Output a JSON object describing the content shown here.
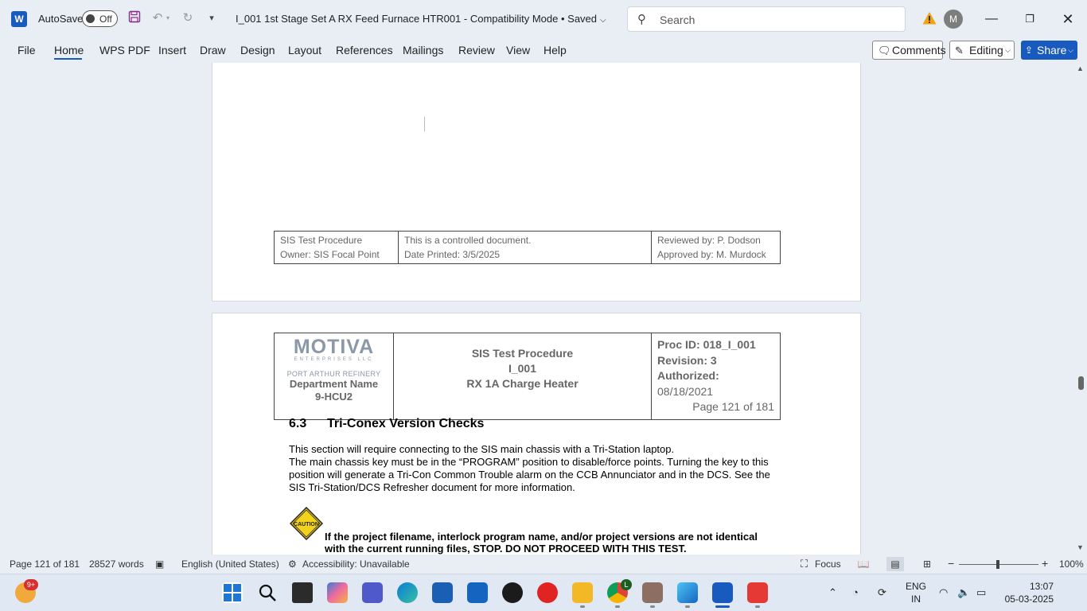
{
  "titlebar": {
    "app_icon": "word-icon",
    "autosave_label": "AutoSave",
    "autosave_state": "Off",
    "document_title": "I_001 1st Stage Set A RX Feed Furnace HTR001  -  Compatibility Mode  •  Saved",
    "search_placeholder": "Search",
    "avatar_initial": "M"
  },
  "ribbon": {
    "tabs": [
      {
        "label": "File"
      },
      {
        "label": "Home"
      },
      {
        "label": "WPS PDF"
      },
      {
        "label": "Insert"
      },
      {
        "label": "Draw"
      },
      {
        "label": "Design"
      },
      {
        "label": "Layout"
      },
      {
        "label": "References"
      },
      {
        "label": "Mailings"
      },
      {
        "label": "Review"
      },
      {
        "label": "View"
      },
      {
        "label": "Help"
      }
    ],
    "active_tab": "Home",
    "comments_label": "Comments",
    "editing_label": "Editing",
    "share_label": "Share"
  },
  "page_footer": {
    "left_1": "SIS Test Procedure",
    "left_2": "Owner: SIS Focal Point",
    "mid_1": "This is a controlled document.",
    "mid_2": "Date Printed: 3/5/2025",
    "right_1": "Reviewed by: P. Dodson",
    "right_2": "Approved by: M. Murdock"
  },
  "page_header": {
    "logo_text": "MOTIVA",
    "logo_sub": "ENTERPRISES LLC",
    "refinery": "PORT ARTHUR REFINERY",
    "dept_1": "Department Name",
    "dept_2": "9-HCU2",
    "title_1": "SIS Test Procedure",
    "title_2": "I_001",
    "title_3": "RX 1A Charge Heater",
    "proc_id": "Proc ID: 018_I_001",
    "revision": "Revision: 3",
    "authorized_label": "Authorized:",
    "authorized_date": " 08/18/2021",
    "page_of": "Page 121 of 181"
  },
  "section": {
    "number": "6.3",
    "title": "Tri-Conex Version Checks",
    "line_1": "This section will require connecting to the SIS main chassis with a Tri-Station laptop.",
    "line_2": "The main chassis key must be in the “PROGRAM” position to disable/force points.  Turning the key to this position will generate a Tri-Con Common Trouble alarm on the CCB Annunciator and in the DCS.  See the SIS Tri-Station/DCS Refresher document for more information.",
    "caution_label": "CAUTION",
    "warning": "If the project filename, interlock program name, and/or project versions are not identical with the current running files, STOP.  DO NOT PROCEED WITH THIS TEST."
  },
  "statusbar": {
    "page": "Page 121 of 181",
    "words": "28527 words",
    "language": "English (United States)",
    "accessibility": "Accessibility: Unavailable",
    "focus": "Focus",
    "zoom": "100%"
  },
  "taskbar": {
    "notification_badge": "9+",
    "chrome_badge": "L",
    "lang_1": "ENG",
    "lang_2": "IN",
    "time": "13:07",
    "date": "05-03-2025"
  },
  "colors": {
    "word_blue": "#185abd",
    "caution_yellow": "#f2d21b"
  }
}
